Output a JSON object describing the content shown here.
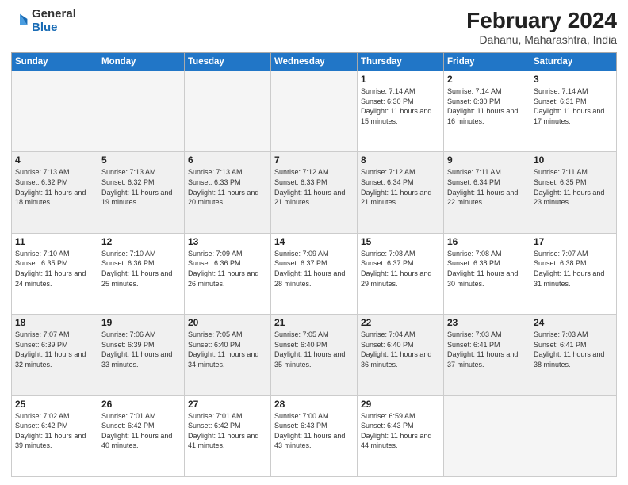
{
  "logo": {
    "general": "General",
    "blue": "Blue"
  },
  "header": {
    "title": "February 2024",
    "location": "Dahanu, Maharashtra, India"
  },
  "weekdays": [
    "Sunday",
    "Monday",
    "Tuesday",
    "Wednesday",
    "Thursday",
    "Friday",
    "Saturday"
  ],
  "weeks": [
    [
      {
        "day": "",
        "empty": true
      },
      {
        "day": "",
        "empty": true
      },
      {
        "day": "",
        "empty": true
      },
      {
        "day": "",
        "empty": true
      },
      {
        "day": "1",
        "sunrise": "7:14 AM",
        "sunset": "6:30 PM",
        "daylight": "11 hours and 15 minutes."
      },
      {
        "day": "2",
        "sunrise": "7:14 AM",
        "sunset": "6:30 PM",
        "daylight": "11 hours and 16 minutes."
      },
      {
        "day": "3",
        "sunrise": "7:14 AM",
        "sunset": "6:31 PM",
        "daylight": "11 hours and 17 minutes."
      }
    ],
    [
      {
        "day": "4",
        "sunrise": "7:13 AM",
        "sunset": "6:32 PM",
        "daylight": "11 hours and 18 minutes."
      },
      {
        "day": "5",
        "sunrise": "7:13 AM",
        "sunset": "6:32 PM",
        "daylight": "11 hours and 19 minutes."
      },
      {
        "day": "6",
        "sunrise": "7:13 AM",
        "sunset": "6:33 PM",
        "daylight": "11 hours and 20 minutes."
      },
      {
        "day": "7",
        "sunrise": "7:12 AM",
        "sunset": "6:33 PM",
        "daylight": "11 hours and 21 minutes."
      },
      {
        "day": "8",
        "sunrise": "7:12 AM",
        "sunset": "6:34 PM",
        "daylight": "11 hours and 21 minutes."
      },
      {
        "day": "9",
        "sunrise": "7:11 AM",
        "sunset": "6:34 PM",
        "daylight": "11 hours and 22 minutes."
      },
      {
        "day": "10",
        "sunrise": "7:11 AM",
        "sunset": "6:35 PM",
        "daylight": "11 hours and 23 minutes."
      }
    ],
    [
      {
        "day": "11",
        "sunrise": "7:10 AM",
        "sunset": "6:35 PM",
        "daylight": "11 hours and 24 minutes."
      },
      {
        "day": "12",
        "sunrise": "7:10 AM",
        "sunset": "6:36 PM",
        "daylight": "11 hours and 25 minutes."
      },
      {
        "day": "13",
        "sunrise": "7:09 AM",
        "sunset": "6:36 PM",
        "daylight": "11 hours and 26 minutes."
      },
      {
        "day": "14",
        "sunrise": "7:09 AM",
        "sunset": "6:37 PM",
        "daylight": "11 hours and 28 minutes."
      },
      {
        "day": "15",
        "sunrise": "7:08 AM",
        "sunset": "6:37 PM",
        "daylight": "11 hours and 29 minutes."
      },
      {
        "day": "16",
        "sunrise": "7:08 AM",
        "sunset": "6:38 PM",
        "daylight": "11 hours and 30 minutes."
      },
      {
        "day": "17",
        "sunrise": "7:07 AM",
        "sunset": "6:38 PM",
        "daylight": "11 hours and 31 minutes."
      }
    ],
    [
      {
        "day": "18",
        "sunrise": "7:07 AM",
        "sunset": "6:39 PM",
        "daylight": "11 hours and 32 minutes."
      },
      {
        "day": "19",
        "sunrise": "7:06 AM",
        "sunset": "6:39 PM",
        "daylight": "11 hours and 33 minutes."
      },
      {
        "day": "20",
        "sunrise": "7:05 AM",
        "sunset": "6:40 PM",
        "daylight": "11 hours and 34 minutes."
      },
      {
        "day": "21",
        "sunrise": "7:05 AM",
        "sunset": "6:40 PM",
        "daylight": "11 hours and 35 minutes."
      },
      {
        "day": "22",
        "sunrise": "7:04 AM",
        "sunset": "6:40 PM",
        "daylight": "11 hours and 36 minutes."
      },
      {
        "day": "23",
        "sunrise": "7:03 AM",
        "sunset": "6:41 PM",
        "daylight": "11 hours and 37 minutes."
      },
      {
        "day": "24",
        "sunrise": "7:03 AM",
        "sunset": "6:41 PM",
        "daylight": "11 hours and 38 minutes."
      }
    ],
    [
      {
        "day": "25",
        "sunrise": "7:02 AM",
        "sunset": "6:42 PM",
        "daylight": "11 hours and 39 minutes."
      },
      {
        "day": "26",
        "sunrise": "7:01 AM",
        "sunset": "6:42 PM",
        "daylight": "11 hours and 40 minutes."
      },
      {
        "day": "27",
        "sunrise": "7:01 AM",
        "sunset": "6:42 PM",
        "daylight": "11 hours and 41 minutes."
      },
      {
        "day": "28",
        "sunrise": "7:00 AM",
        "sunset": "6:43 PM",
        "daylight": "11 hours and 43 minutes."
      },
      {
        "day": "29",
        "sunrise": "6:59 AM",
        "sunset": "6:43 PM",
        "daylight": "11 hours and 44 minutes."
      },
      {
        "day": "",
        "empty": true
      },
      {
        "day": "",
        "empty": true
      }
    ]
  ],
  "labels": {
    "sunrise": "Sunrise:",
    "sunset": "Sunset:",
    "daylight": "Daylight:"
  }
}
